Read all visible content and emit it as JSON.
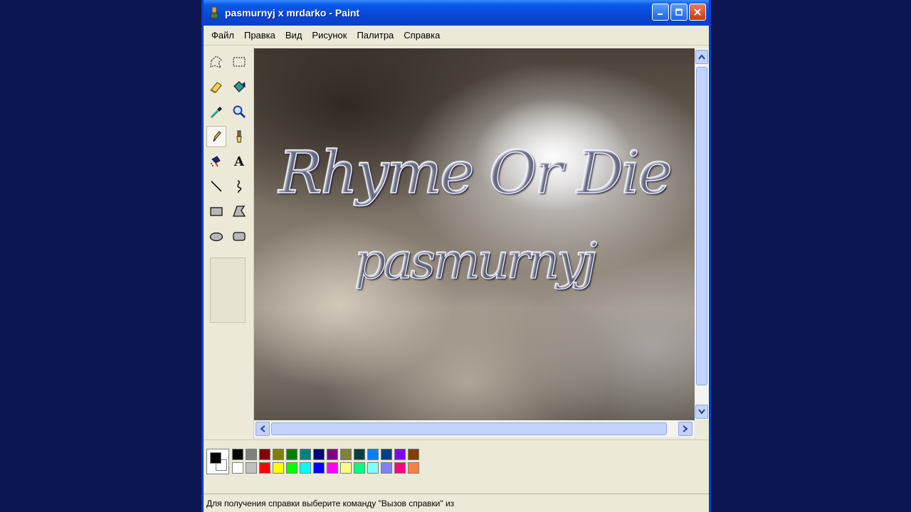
{
  "window": {
    "title": "pasmurnyj x mrdarko - Paint",
    "app_icon": "paint-palette-icon",
    "buttons": [
      "minimize-icon",
      "maximize-icon",
      "close-icon"
    ]
  },
  "menu": [
    {
      "label": "Файл"
    },
    {
      "label": "Правка"
    },
    {
      "label": "Вид"
    },
    {
      "label": "Рисунок"
    },
    {
      "label": "Палитра"
    },
    {
      "label": "Справка"
    }
  ],
  "tools": [
    {
      "icon": "free-form-select-icon"
    },
    {
      "icon": "rect-select-icon"
    },
    {
      "icon": "eraser-icon"
    },
    {
      "icon": "fill-bucket-icon"
    },
    {
      "icon": "color-picker-icon"
    },
    {
      "icon": "magnifier-icon"
    },
    {
      "icon": "pencil-icon",
      "selected": true
    },
    {
      "icon": "brush-icon"
    },
    {
      "icon": "airbrush-icon"
    },
    {
      "icon": "text-icon",
      "glyph": "A"
    },
    {
      "icon": "line-icon"
    },
    {
      "icon": "curve-icon"
    },
    {
      "icon": "rectangle-icon"
    },
    {
      "icon": "polygon-icon"
    },
    {
      "icon": "ellipse-icon"
    },
    {
      "icon": "rounded-rect-icon"
    }
  ],
  "canvas": {
    "title_text": "Rhyme Or Die",
    "subtitle_text": "pasmurnyj"
  },
  "colors": {
    "foreground": "#000000",
    "background": "#ffffff",
    "palette_top": [
      "#000000",
      "#808080",
      "#800000",
      "#808000",
      "#008000",
      "#008080",
      "#000080",
      "#800080",
      "#808040",
      "#004040",
      "#0080ff",
      "#004080",
      "#8000ff",
      "#804000"
    ],
    "palette_bottom": [
      "#ffffff",
      "#c0c0c0",
      "#ff0000",
      "#ffff00",
      "#00ff00",
      "#00ffff",
      "#0000ff",
      "#ff00ff",
      "#ffff80",
      "#00ff80",
      "#80ffff",
      "#8080ff",
      "#ff0080",
      "#ff8040"
    ]
  },
  "status": {
    "text": "Для получения справки выберите команду \"Вызов справки\" из"
  }
}
